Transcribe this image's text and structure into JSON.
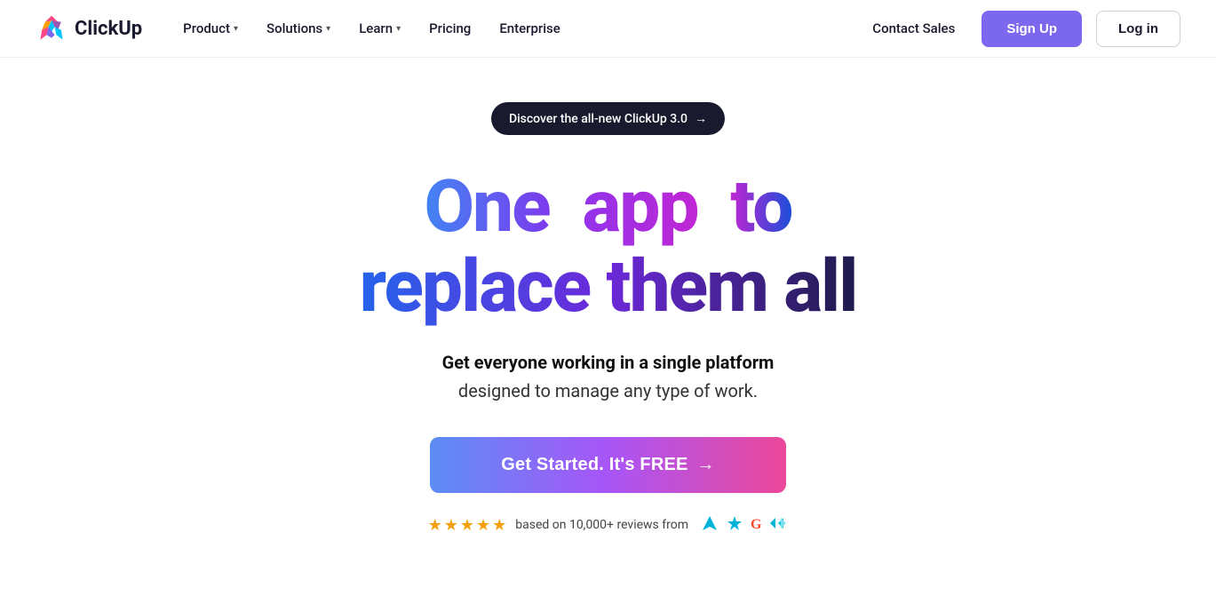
{
  "navbar": {
    "logo_text": "ClickUp",
    "nav_items": [
      {
        "label": "Product",
        "has_dropdown": true
      },
      {
        "label": "Solutions",
        "has_dropdown": true
      },
      {
        "label": "Learn",
        "has_dropdown": true
      },
      {
        "label": "Pricing",
        "has_dropdown": false
      },
      {
        "label": "Enterprise",
        "has_dropdown": false
      }
    ],
    "contact_sales": "Contact Sales",
    "signup_label": "Sign Up",
    "login_label": "Log in"
  },
  "hero": {
    "announcement_text": "Discover the all-new ClickUp 3.0",
    "announcement_arrow": "→",
    "headline_word1": "One",
    "headline_word2": "app",
    "headline_word3": "to",
    "headline_line2": "replace them all",
    "subtitle_bold": "Get everyone working in a single platform",
    "subtitle_regular": "designed to manage any type of work.",
    "cta_label": "Get Started. It's FREE",
    "cta_arrow": "→",
    "review_text": "based on 10,000+ reviews from"
  }
}
